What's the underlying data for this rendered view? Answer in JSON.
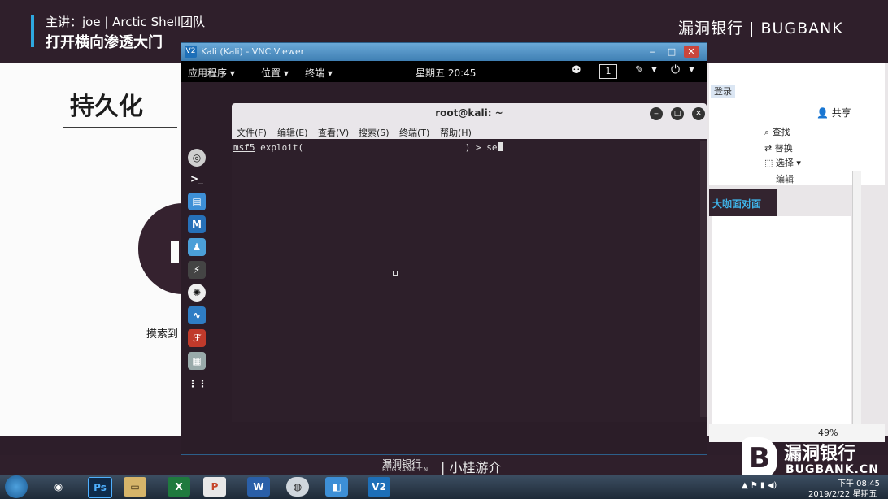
{
  "banner": {
    "presenter": "主讲：joe | Arctic Shell团队",
    "course_title": "打开横向渗透大门",
    "brand_top": "漏洞银行 | BUGBANK"
  },
  "slide": {
    "title": "持久化",
    "caption": "摸索到"
  },
  "right_pane": {
    "tab": "登录",
    "share": "共享",
    "find": "查找",
    "replace": "替换",
    "select": "选择",
    "edit_group": "编辑",
    "nav_label": "大咖面对面",
    "zoom": "49%"
  },
  "vnc": {
    "title": "Kali (Kali) - VNC Viewer"
  },
  "kali_topbar": {
    "apps": "应用程序 ▾",
    "places": "位置 ▾",
    "terminal": "终端 ▾",
    "clock": "星期五 20:45",
    "workspace": "1"
  },
  "terminal": {
    "title": "root@kali: ~",
    "menu": [
      "文件(F)",
      "编辑(E)",
      "查看(V)",
      "搜索(S)",
      "终端(T)",
      "帮助(H)"
    ],
    "prompt": "msf5",
    "command_prefix": " exploit(",
    "command_suffix": "                              ) > se"
  },
  "bottom_brand": {
    "cn": "漏洞银行",
    "en": "BUGBANK.CN",
    "motto": "| 小桂游介",
    "logo_cn": "漏洞银行",
    "logo_en": "BUGBANK.CN"
  },
  "taskbar": {
    "time": "下午 08:45",
    "date": "2019/2/22 星期五",
    "icons": [
      "chrome-icon",
      "photoshop-icon",
      "explorer-icon",
      "excel-icon",
      "powerpoint-icon",
      "word-icon",
      "player-icon",
      "vmware-icon",
      "vnc-icon"
    ]
  },
  "colors": {
    "accent": "#2ea8e0",
    "banner_bg": "#2f1f2b",
    "terminal_bg": "#2d1f2a"
  }
}
